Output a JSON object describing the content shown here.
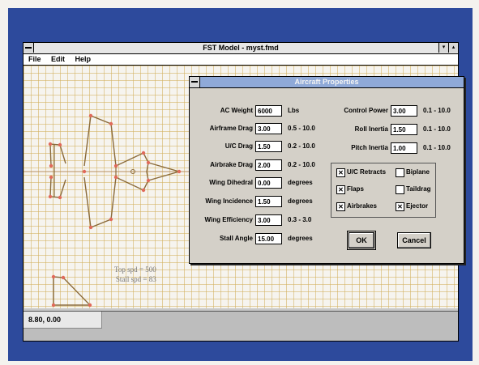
{
  "window": {
    "title": "FST Model - myst.fmd",
    "menu": [
      "File",
      "Edit",
      "Help"
    ],
    "minimize_glyph": "▾",
    "maximize_glyph": "▴"
  },
  "canvas": {
    "top_speed": "Top spd = 500",
    "stall_speed": "Stall spd = 83"
  },
  "status": {
    "coords": "8.80, 0.00"
  },
  "dialog": {
    "title": "Aircraft Properties",
    "left_fields": [
      {
        "label": "AC Weight",
        "value": "6000",
        "range": "Lbs"
      },
      {
        "label": "Airframe Drag",
        "value": "3.00",
        "range": "0.5 - 10.0"
      },
      {
        "label": "U/C Drag",
        "value": "1.50",
        "range": "0.2 - 10.0"
      },
      {
        "label": "Airbrake Drag",
        "value": "2.00",
        "range": "0.2 - 10.0"
      },
      {
        "label": "Wing Dihedral",
        "value": "0.00",
        "range": "degrees"
      },
      {
        "label": "Wing Incidence",
        "value": "1.50",
        "range": "degrees"
      },
      {
        "label": "Wing Efficiency",
        "value": "3.00",
        "range": "0.3 - 3.0"
      },
      {
        "label": "Stall Angle",
        "value": "15.00",
        "range": "degrees"
      }
    ],
    "right_fields": [
      {
        "label": "Control Power",
        "value": "3.00",
        "range": "0.1 - 10.0"
      },
      {
        "label": "Roll Inertia",
        "value": "1.50",
        "range": "0.1 - 10.0"
      },
      {
        "label": "Pitch Inertia",
        "value": "1.00",
        "range": "0.1 - 10.0"
      }
    ],
    "checkboxes": [
      {
        "label": "U/C Retracts",
        "checked": true
      },
      {
        "label": "Biplane",
        "checked": false
      },
      {
        "label": "Flaps",
        "checked": true
      },
      {
        "label": "Taildrag",
        "checked": false
      },
      {
        "label": "Airbrakes",
        "checked": true
      },
      {
        "label": "Ejector",
        "checked": true
      }
    ],
    "ok_label": "OK",
    "cancel_label": "Cancel"
  },
  "colors": {
    "desktop": "#2d4a9c",
    "aircraft_outline": "#8a6a3a",
    "vertex_marker": "#e06a5a",
    "grid": "#d2af5a"
  }
}
